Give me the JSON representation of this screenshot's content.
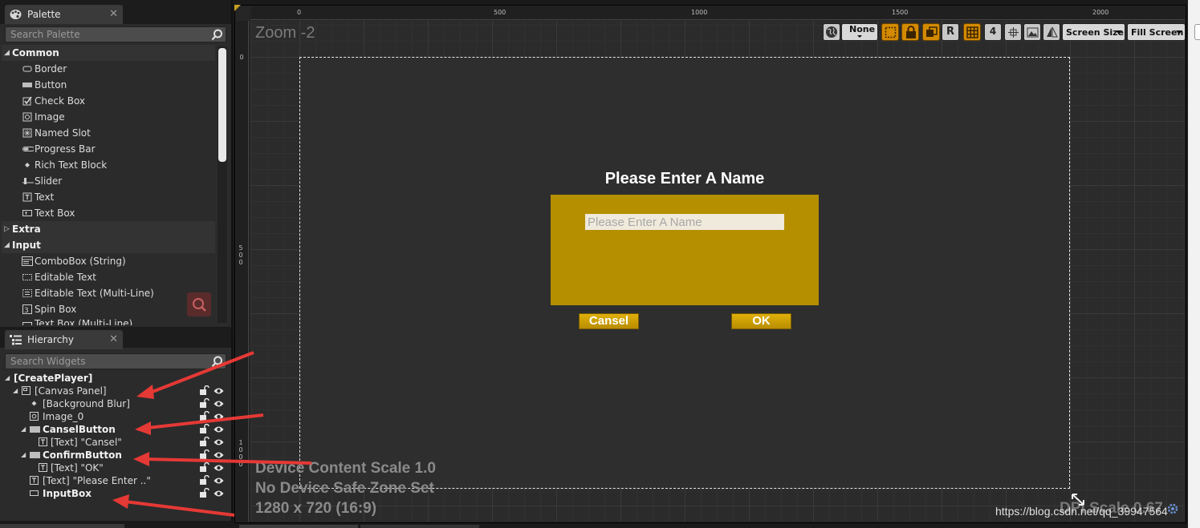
{
  "palette": {
    "tab_label": "Palette",
    "search_placeholder": "Search Palette",
    "categories": [
      {
        "label": "Common",
        "items": [
          "Border",
          "Button",
          "Check Box",
          "Image",
          "Named Slot",
          "Progress Bar",
          "Rich Text Block",
          "Slider",
          "Text",
          "Text Box"
        ]
      },
      {
        "label": "Extra"
      },
      {
        "label": "Input",
        "items": [
          "ComboBox (String)",
          "Editable Text",
          "Editable Text (Multi-Line)",
          "Spin Box",
          "Text Box (Multi-Line)"
        ]
      }
    ]
  },
  "hierarchy": {
    "tab_label": "Hierarchy",
    "search_placeholder": "Search Widgets",
    "items": [
      {
        "label": "[CreatePlayer]"
      },
      {
        "label": "[Canvas Panel]"
      },
      {
        "label": "[Background Blur]"
      },
      {
        "label": "Image_0"
      },
      {
        "label": "CanselButton"
      },
      {
        "label": "[Text] \"Cansel\""
      },
      {
        "label": "ConfirmButton"
      },
      {
        "label": "[Text] \"OK\""
      },
      {
        "label": "[Text] \"Please Enter ..\""
      },
      {
        "label": "InputBox"
      }
    ]
  },
  "designer": {
    "zoom_label": "Zoom -2",
    "ruler_top": [
      "0",
      "500",
      "1000",
      "1500",
      "2000"
    ],
    "ruler_left": [
      "0",
      "500",
      "1000"
    ],
    "toolbar": {
      "none_label": "None",
      "r_label": "R",
      "grid_num": "4",
      "screen_size_label": "Screen Size",
      "fill_screen_label": "Fill Screen"
    },
    "dialog": {
      "title": "Please Enter A Name",
      "input_placeholder": "Please Enter A Name",
      "cancel_label": "Cansel",
      "ok_label": "OK"
    },
    "info": {
      "content_scale": "Device Content Scale 1.0",
      "safe_zone": "No Device Safe Zone Set",
      "resolution": "1280 x 720 (16:9)",
      "dpi_scale": "DPI Scale 0.67"
    },
    "watermark": "https://blog.csdn.net/qq_39947564"
  },
  "colors": {
    "dialog_bg": "#b58f00",
    "button_yellow": "#d9a800",
    "toolbar_orange": "#d48a00",
    "arrow_red": "#e53935"
  }
}
